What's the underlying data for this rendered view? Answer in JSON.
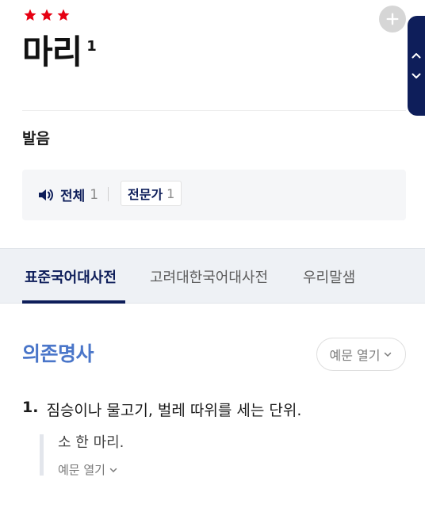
{
  "entry": {
    "stars_count": 3,
    "headword": "마리",
    "homonym_number": "1"
  },
  "pronunciation": {
    "label": "발음",
    "all_label": "전체",
    "all_count": "1",
    "expert_label": "전문가",
    "expert_count": "1"
  },
  "tabs": [
    {
      "label": "표준국어대사전",
      "active": true
    },
    {
      "label": "고려대한국어대사전",
      "active": false
    },
    {
      "label": "우리말샘",
      "active": false
    }
  ],
  "definition": {
    "part_of_speech": "의존명사",
    "example_toggle_label": "예문 열기",
    "senses": [
      {
        "number": "1.",
        "text": "짐승이나 물고기, 벌레 따위를 세는 단위.",
        "example": "소 한 마리.",
        "example_more_label": "예문 열기"
      }
    ]
  },
  "colors": {
    "navy": "#0e1e5a",
    "star_red": "#e60012",
    "pos_blue": "#4a76c9"
  },
  "icons": {
    "star": "star-icon",
    "add": "plus-circle-icon",
    "up": "chevron-up-icon",
    "down": "chevron-down-icon",
    "speaker": "speaker-icon"
  }
}
